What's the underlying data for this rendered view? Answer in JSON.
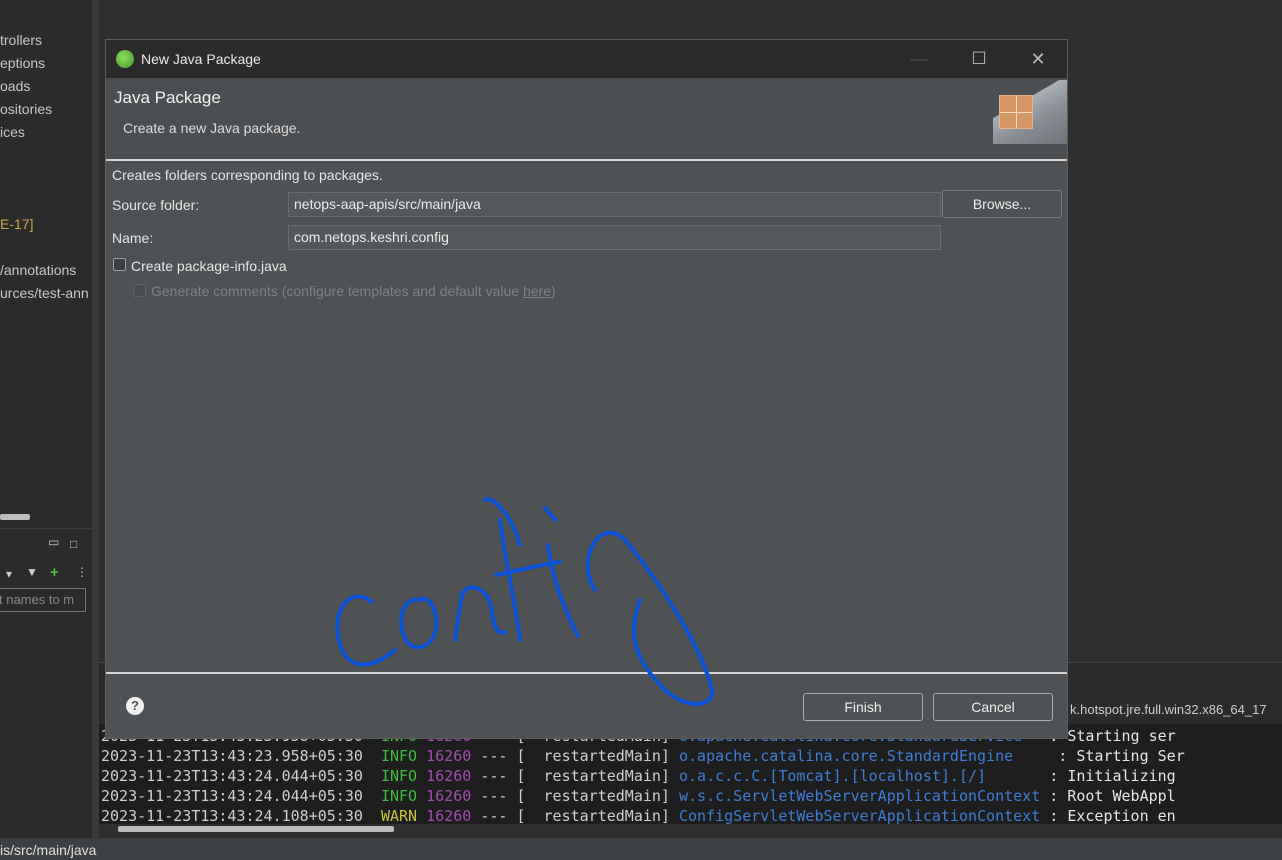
{
  "ide": {
    "tree_items": [
      {
        "label": "trollers",
        "class": ""
      },
      {
        "label": "eptions",
        "class": ""
      },
      {
        "label": "oads",
        "class": ""
      },
      {
        "label": "ositories",
        "class": ""
      },
      {
        "label": "ices",
        "class": ""
      },
      {
        "label": "E-17]",
        "class": "jre"
      },
      {
        "label": "/annotations",
        "class": ""
      },
      {
        "label": "urces/test-ann",
        "class": ""
      }
    ],
    "filter_placeholder": "t names to m",
    "console_path": "k.hotspot.jre.full.win32.x86_64_17",
    "console_lines": [
      {
        "ts": "2023-11-23T13:43:23.958+05:30",
        "level": "INFO",
        "pid": "16260",
        "sep": "---",
        "thread": "[  restartedMain]",
        "logger": "o.apache.catalina.core.StandardService  ",
        "msg": ": Starting ser"
      },
      {
        "ts": "2023-11-23T13:43:23.958+05:30",
        "level": "INFO",
        "pid": "16260",
        "sep": "---",
        "thread": "[  restartedMain]",
        "logger": "o.apache.catalina.core.StandardEngine    ",
        "msg": ": Starting Ser"
      },
      {
        "ts": "2023-11-23T13:43:24.044+05:30",
        "level": "INFO",
        "pid": "16260",
        "sep": "---",
        "thread": "[  restartedMain]",
        "logger": "o.a.c.c.C.[Tomcat].[localhost].[/]      ",
        "msg": ": Initializing"
      },
      {
        "ts": "2023-11-23T13:43:24.044+05:30",
        "level": "INFO",
        "pid": "16260",
        "sep": "---",
        "thread": "[  restartedMain]",
        "logger": "w.s.c.ServletWebServerApplicationContext",
        "msg": ": Root WebAppl"
      },
      {
        "ts": "2023-11-23T13:43:24.108+05:30",
        "level": "WARN",
        "pid": "16260",
        "sep": "---",
        "thread": "[  restartedMain]",
        "logger": "ConfigServletWebServerApplicationContext",
        "msg": ": Exception en"
      }
    ],
    "status_text": "is/src/main/java"
  },
  "dialog": {
    "title": "New Java Package",
    "header_title": "Java Package",
    "header_subtitle": "Create a new Java package.",
    "info_text": "Creates folders corresponding to packages.",
    "source_folder_label": "Source folder:",
    "source_folder_value": "netops-aap-apis/src/main/java",
    "browse_label": "Browse...",
    "name_label": "Name:",
    "name_value": "com.netops.keshri.config",
    "create_package_info_label": "Create package-info.java",
    "create_package_info_checked": false,
    "generate_comments_label": "Generate comments (configure templates and default value ",
    "generate_comments_link": "here",
    "generate_comments_suffix": ")",
    "finish_label": "Finish",
    "cancel_label": "Cancel",
    "help_icon": "?"
  },
  "annotation": {
    "text": "config",
    "color": "#0a52d6"
  }
}
